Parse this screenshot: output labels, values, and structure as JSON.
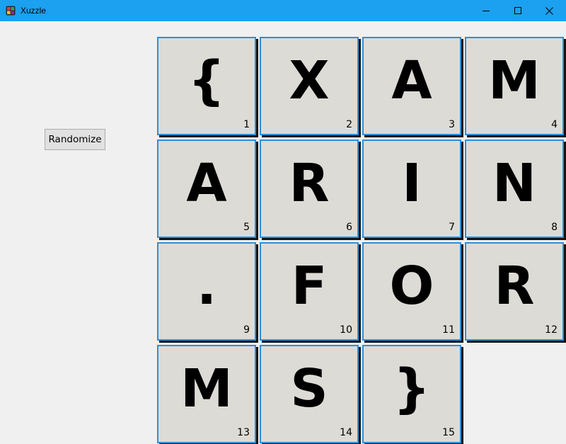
{
  "window": {
    "title": "Xuzzle",
    "controls": {
      "minimize_icon": "minimize-icon",
      "maximize_icon": "maximize-icon",
      "close_icon": "close-icon"
    }
  },
  "toolbar": {
    "randomize_label": "Randomize"
  },
  "colors": {
    "titlebar": "#1ba1f0",
    "tile_bg": "#dddbd6",
    "tile_border": "#2e8fd8"
  },
  "tiles": [
    {
      "letter": "{",
      "number": "1"
    },
    {
      "letter": "X",
      "number": "2"
    },
    {
      "letter": "A",
      "number": "3"
    },
    {
      "letter": "M",
      "number": "4"
    },
    {
      "letter": "A",
      "number": "5"
    },
    {
      "letter": "R",
      "number": "6"
    },
    {
      "letter": "I",
      "number": "7"
    },
    {
      "letter": "N",
      "number": "8"
    },
    {
      "letter": ".",
      "number": "9"
    },
    {
      "letter": "F",
      "number": "10"
    },
    {
      "letter": "O",
      "number": "11"
    },
    {
      "letter": "R",
      "number": "12"
    },
    {
      "letter": "M",
      "number": "13"
    },
    {
      "letter": "S",
      "number": "14"
    },
    {
      "letter": "}",
      "number": "15"
    }
  ]
}
